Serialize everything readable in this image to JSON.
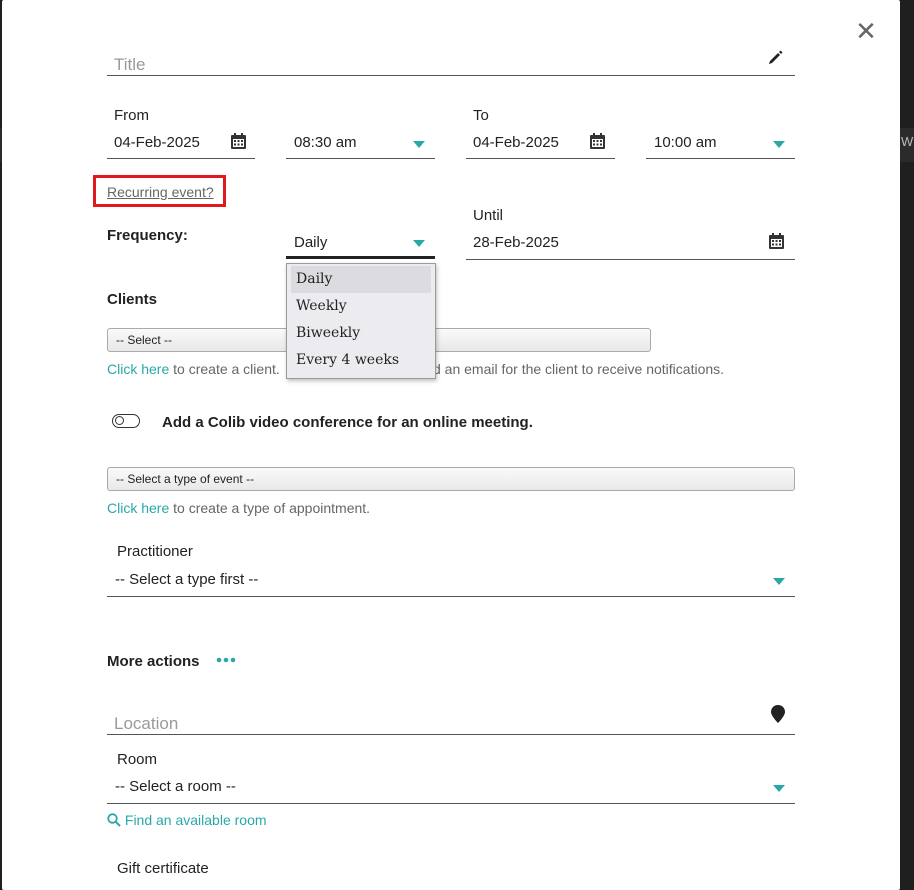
{
  "form": {
    "title_placeholder": "Title",
    "from_label": "From",
    "from_date": "04-Feb-2025",
    "from_time": "08:30 am",
    "to_label": "To",
    "to_date": "04-Feb-2025",
    "to_time": "10:00 am",
    "recurring_link": "Recurring event?",
    "frequency_label": "Frequency:",
    "frequency_value": "Daily",
    "frequency_options": [
      "Daily",
      "Weekly",
      "Biweekly",
      "Every 4 weeks"
    ],
    "until_label": "Until",
    "until_date": "28-Feb-2025",
    "clients_label": "Clients",
    "clients_select": "-- Select --",
    "client_hint_link": "Click here",
    "client_hint_text_a": "to create a client.",
    "client_hint_text_b": "d an email for the client to receive notifications.",
    "video_label": "Add a Colib video conference for an online meeting.",
    "event_type_select": "-- Select a type of event --",
    "type_hint_link": "Click here",
    "type_hint_text": "to create a type of appointment.",
    "practitioner_label": "Practitioner",
    "practitioner_value": "-- Select a type first --",
    "more_actions_label": "More actions",
    "location_placeholder": "Location",
    "room_label": "Room",
    "room_value": "-- Select a room --",
    "find_room_link": "Find an available room",
    "gift_label": "Gift certificate"
  },
  "icons": {
    "close": "close-icon",
    "pencil": "pencil-icon",
    "calendar": "calendar-icon",
    "pin": "map-pin-icon",
    "search": "search-icon",
    "dots": "more-dots-icon"
  },
  "colors": {
    "accent": "#2aa8a8",
    "highlight_box": "#e0191f"
  }
}
